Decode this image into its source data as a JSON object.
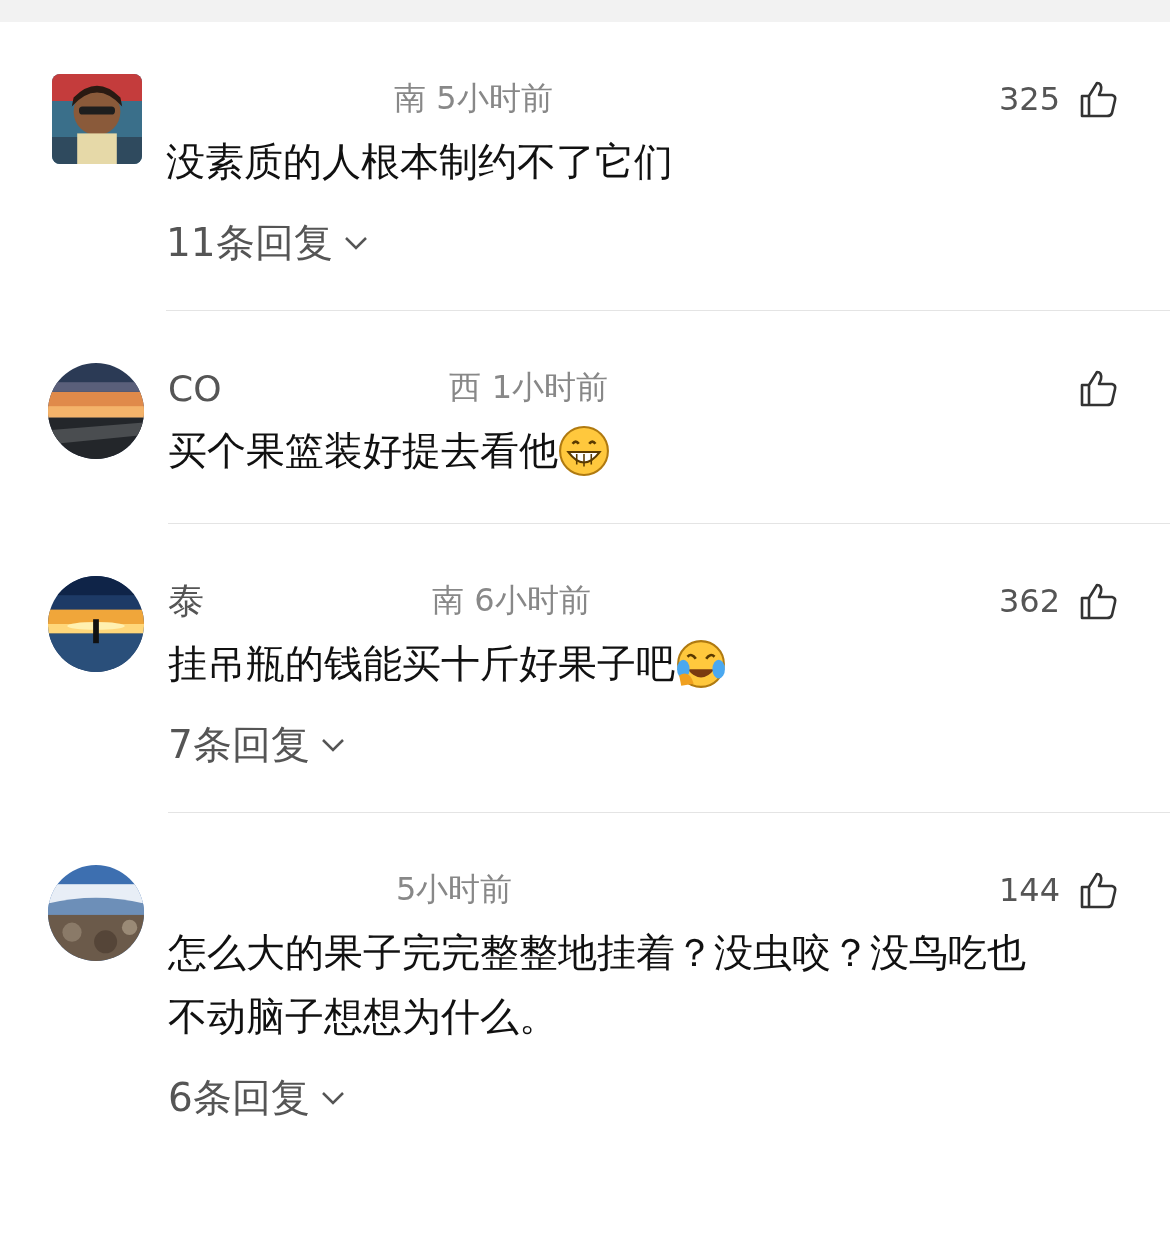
{
  "comments": [
    {
      "avatar": {
        "kind": "square"
      },
      "meta": "南 5小时前",
      "likes": "325",
      "text": "没素质的人根本制约不了它们",
      "replies": "11条回复"
    },
    {
      "avatar": {
        "kind": "round"
      },
      "name": "CO",
      "meta": "西 1小时前",
      "text": "买个果篮装好提去看他",
      "emoji": {
        "kind": "grin"
      }
    },
    {
      "avatar": {
        "kind": "round"
      },
      "name": "泰",
      "meta": "南 6小时前",
      "likes": "362",
      "text": "挂吊瓶的钱能买十斤好果子吧",
      "emoji": {
        "kind": "laugh-cry"
      },
      "replies": "7条回复"
    },
    {
      "avatar": {
        "kind": "round"
      },
      "meta": "5小时前",
      "likes": "144",
      "text": "怎么大的果子完完整整地挂着？没虫咬？没鸟吃也不动脑子想想为什么。",
      "replies": "6条回复"
    }
  ]
}
